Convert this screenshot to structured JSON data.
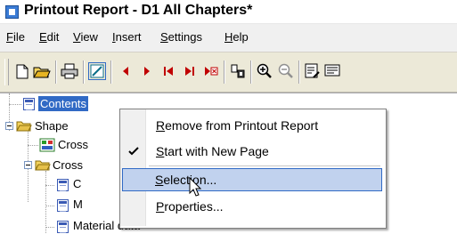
{
  "window": {
    "title": "Printout Report - D1 All Chapters*",
    "icon": "report-app-icon"
  },
  "menu": {
    "items": [
      {
        "label": "File",
        "underline": "F"
      },
      {
        "label": "Edit",
        "underline": "E"
      },
      {
        "label": "View",
        "underline": "V"
      },
      {
        "label": "Insert",
        "underline": "I"
      },
      {
        "label": "Settings",
        "underline": "S"
      },
      {
        "label": "Help",
        "underline": "H"
      }
    ]
  },
  "toolbar": {
    "icons": [
      "new-document-icon",
      "open-folder-icon",
      "print-icon",
      "edit-page-icon",
      "previous-icon",
      "next-icon",
      "first-page-icon",
      "last-page-icon",
      "goto-page-icon",
      "layout-icon",
      "zoom-in-icon",
      "zoom-out-icon",
      "properties-icon",
      "print-preview-icon"
    ],
    "accent": "#c00000"
  },
  "tree": {
    "nodes": [
      {
        "label": "Contents",
        "selected": true
      },
      {
        "label": "Shape"
      },
      {
        "label": "Cross"
      },
      {
        "label": "Cross"
      },
      {
        "label": "C"
      },
      {
        "label": "M"
      },
      {
        "label": "Material data"
      }
    ]
  },
  "context_menu": {
    "items": [
      {
        "label": "Remove from Printout Report",
        "underline": "R",
        "checked": false
      },
      {
        "label": "Start with New Page",
        "underline": "S",
        "checked": true
      },
      {
        "label": "Selection...",
        "underline": "S",
        "highlighted": true
      },
      {
        "label": "Properties...",
        "underline": "P",
        "checked": false
      }
    ]
  },
  "colors": {
    "selection": "#316ac5",
    "highlight": "#c1d2ee"
  }
}
